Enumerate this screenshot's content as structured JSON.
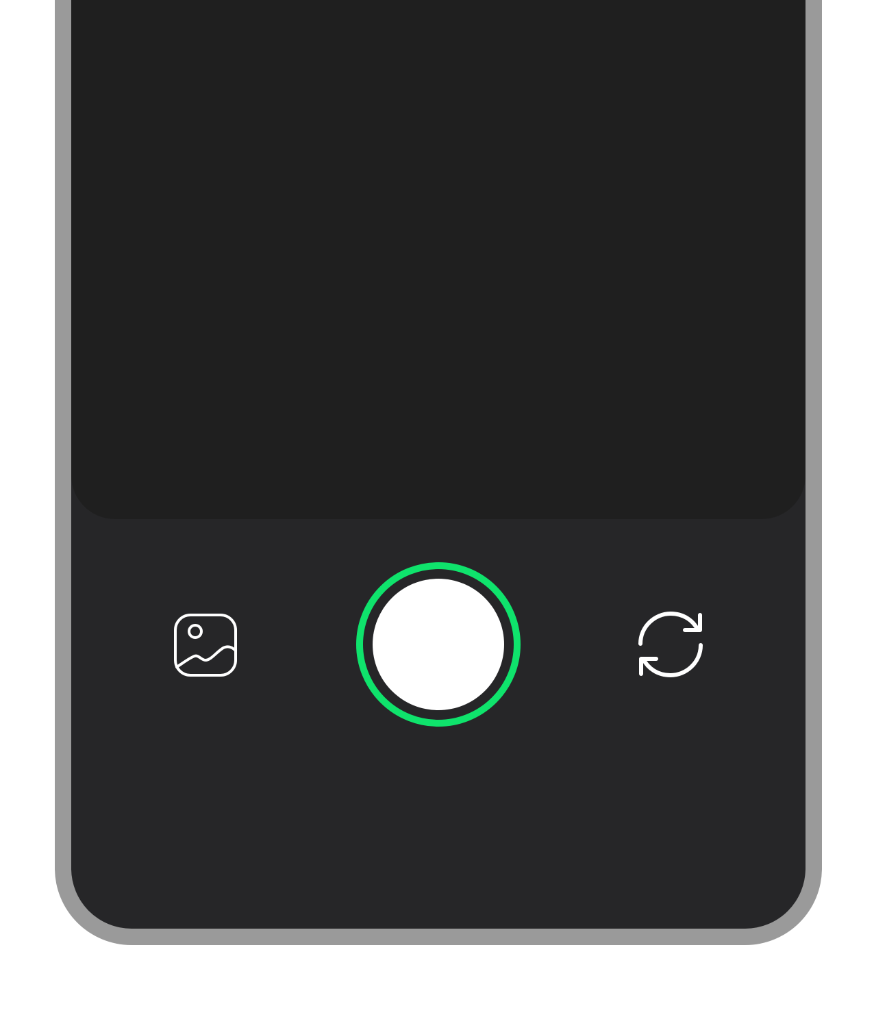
{
  "app": {
    "screen": "camera"
  },
  "controls": {
    "gallery": {
      "icon": "image-gallery-icon"
    },
    "shutter": {
      "icon": "shutter-icon",
      "ring_color": "#0fe36c"
    },
    "flip_camera": {
      "icon": "refresh-flip-icon"
    }
  },
  "colors": {
    "frame": "#9a9a9a",
    "screen_bg": "#262628",
    "viewfinder_bg": "#1f1f1f",
    "accent": "#0fe36c",
    "icon": "#ffffff"
  }
}
